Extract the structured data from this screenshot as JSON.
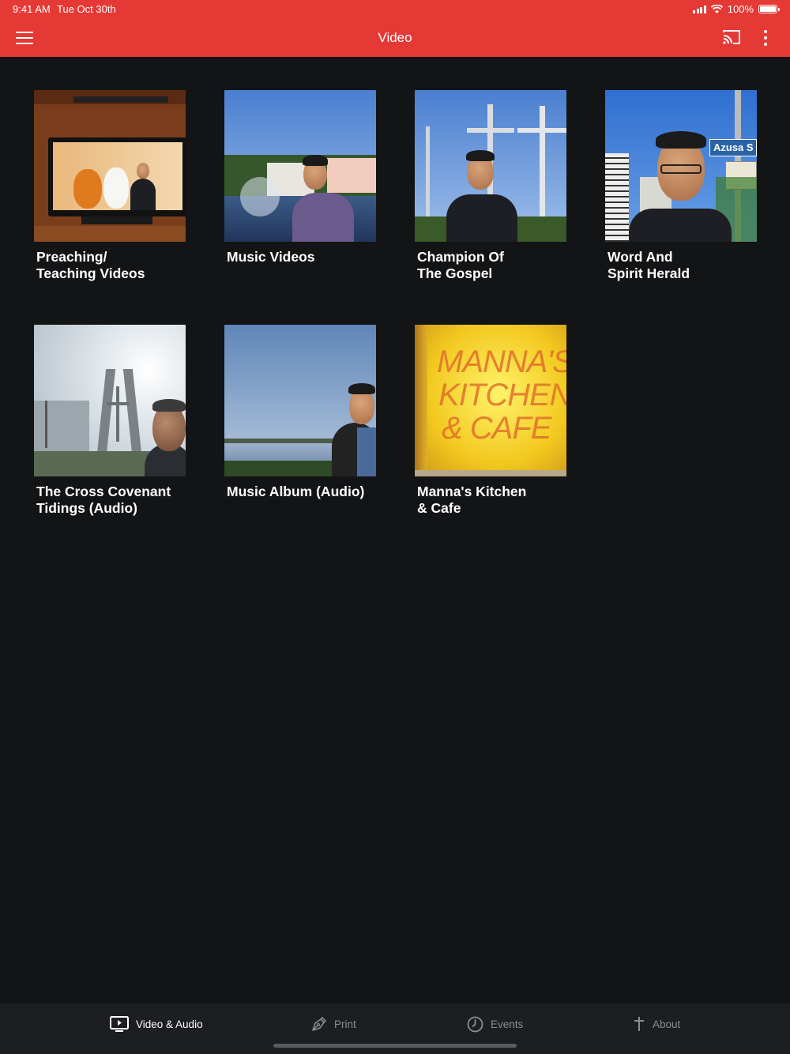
{
  "status_bar": {
    "time": "9:41 AM",
    "date": "Tue Oct 30th",
    "battery_label": "100%",
    "icons": [
      "signal-icon",
      "wifi-icon",
      "battery-icon"
    ]
  },
  "app_bar": {
    "title": "Video",
    "left_icon": "menu-icon",
    "right_icons": [
      "cast-icon",
      "more-vertical-icon"
    ],
    "color": "#e53935"
  },
  "tiles": [
    {
      "label": "Preaching/\nTeaching Videos"
    },
    {
      "label": "Music Videos"
    },
    {
      "label": "Champion Of\nThe Gospel"
    },
    {
      "label": "Word And\nSpirit Herald"
    },
    {
      "label": "The Cross Covenant\nTidings (Audio)"
    },
    {
      "label": "Music Album (Audio)"
    },
    {
      "label": "Manna's Kitchen\n& Cafe"
    }
  ],
  "thumb_text": {
    "sign_street": "Azusa S",
    "manna_line1": "MANNA'S",
    "manna_line2": "KITCHEN",
    "manna_line3": "& CAFE"
  },
  "bottom_nav": {
    "items": [
      {
        "label": "Video & Audio",
        "icon": "tv-play-icon",
        "active": true
      },
      {
        "label": "Print",
        "icon": "pen-nib-icon",
        "active": false
      },
      {
        "label": "Events",
        "icon": "clock-icon",
        "active": false
      },
      {
        "label": "About",
        "icon": "cross-icon",
        "active": false
      }
    ]
  },
  "colors": {
    "background": "#131416",
    "accent": "#e53935",
    "nav_background": "#1d1e21",
    "nav_inactive": "#8d8e92"
  }
}
